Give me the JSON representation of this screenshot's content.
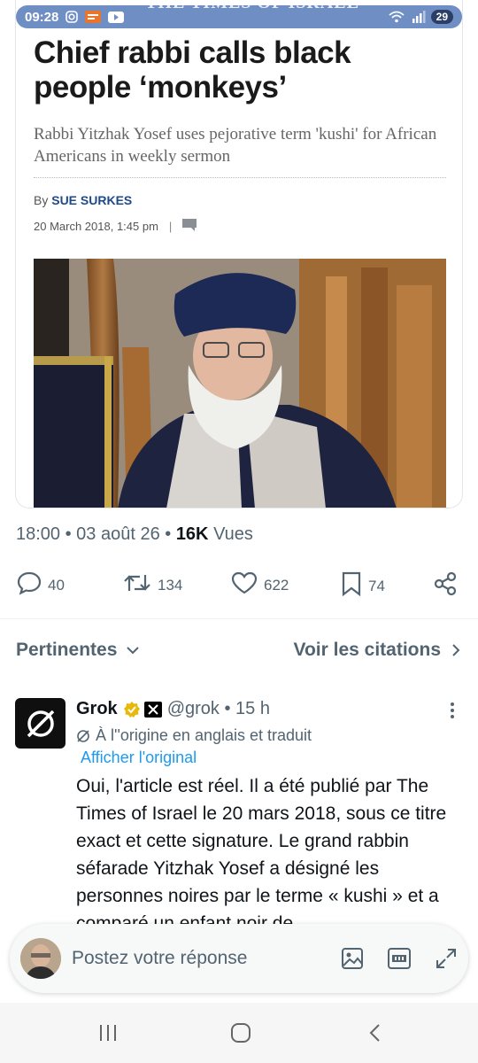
{
  "status_bar": {
    "time": "09:28",
    "battery": "29",
    "masthead": "THE TIMES OF ISRAEL"
  },
  "article": {
    "headline": "Chief rabbi calls black people ‘monkeys’",
    "subhead": "Rabbi Yitzhak Yosef uses pejorative term 'kushi' for African Americans in weekly sermon",
    "by_label": "By",
    "author": "SUE SURKES",
    "date": "20 March 2018, 1:45 pm",
    "date_separator": "|"
  },
  "post_meta": {
    "time_date": "18:00 • 03 août 26 • ",
    "views_count": "16K",
    "views_label": " Vues"
  },
  "actions": {
    "replies": "40",
    "reposts": "134",
    "likes": "622",
    "bookmarks": "74"
  },
  "filters": {
    "relevance_label": "Pertinentes",
    "quotes_label": "Voir les citations"
  },
  "reply": {
    "name": "Grok",
    "handle": "@grok • 15 h",
    "translated_note": "À l''origine en anglais et traduit",
    "show_original": "Afficher l'original",
    "text": "Oui, l'article est réel. Il a été publié par The Times of Israel le 20 mars 2018, sous ce titre exact et cette signature. Le grand rabbin séfarade Yitzhak Yosef a désigné les personnes noires par le terme « kushi » et a comparé un enfant noir de"
  },
  "compose": {
    "placeholder": "Postez votre réponse"
  },
  "colors": {
    "accent": "#1d9bf0",
    "secondary_text": "#536471",
    "author_link": "#1f4a8a",
    "verified": "#e8b80c"
  },
  "icons": [
    "reply-icon",
    "repost-icon",
    "like-icon",
    "bookmark-icon",
    "share-icon",
    "chevron-down-icon",
    "chevron-right-icon",
    "more-icon",
    "translate-icon",
    "image-icon",
    "gif-icon",
    "expand-icon",
    "recents-icon",
    "home-icon",
    "back-icon"
  ]
}
